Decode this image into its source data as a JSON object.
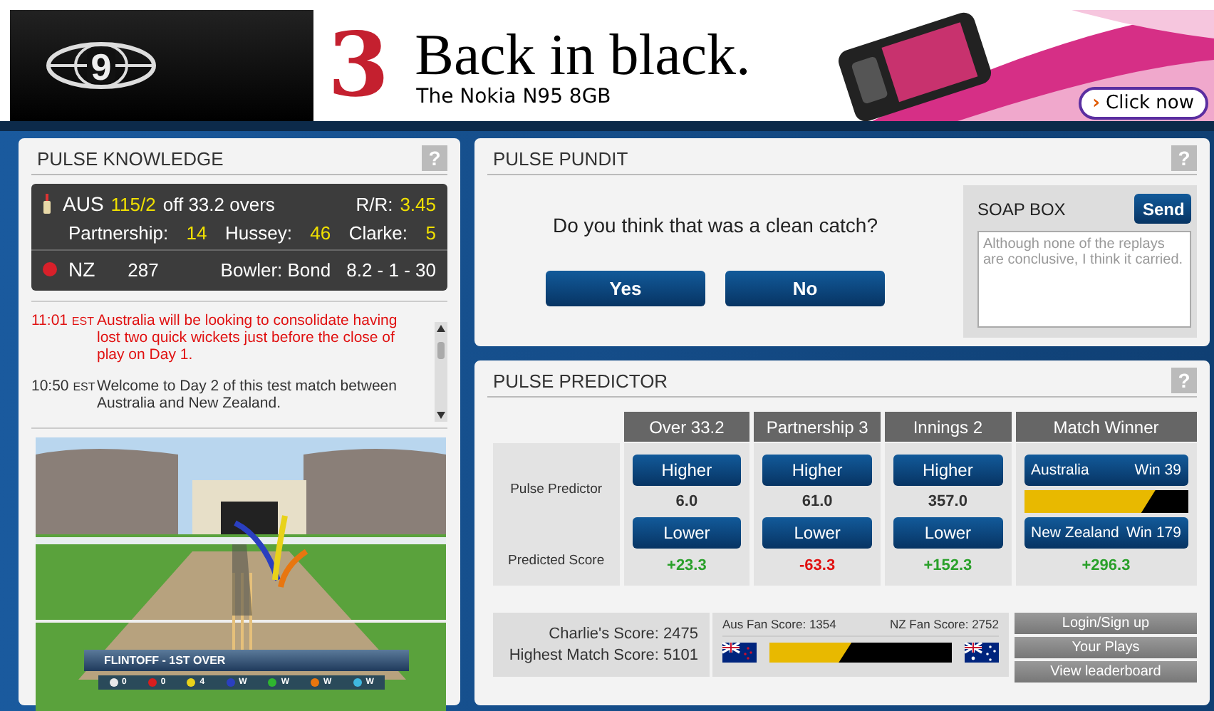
{
  "banner": {
    "logo": "9",
    "brand_mark": "3",
    "headline": "Back in black.",
    "subline": "The Nokia N95 8GB",
    "cta_icon": "›",
    "cta": "Click now"
  },
  "knowledge": {
    "title": "PULSE KNOWLEDGE",
    "help": "?",
    "batting": {
      "team": "AUS",
      "score": "115/2",
      "overs_text": "off 33.2 overs",
      "rr_label": "R/R:",
      "rr": "3.45",
      "stats": [
        {
          "label": "Partnership:",
          "value": "14"
        },
        {
          "label": "Hussey:",
          "value": "46"
        },
        {
          "label": "Clarke:",
          "value": "5"
        }
      ]
    },
    "bowling": {
      "team": "NZ",
      "score": "287",
      "bowler": "Bowler: Bond",
      "figures": "8.2 - 1 - 30"
    },
    "feed": [
      {
        "time": "11:01",
        "zone": "EST",
        "text": "Australia will be looking to consolidate having lost two quick wickets just before the close of play on Day 1.",
        "highlight": true
      },
      {
        "time": "10:50",
        "zone": "EST",
        "text": "Welcome to Day 2 of this test match between Australia and New Zealand.",
        "highlight": false
      }
    ],
    "video": {
      "kind": "picture",
      "caption": "FLINTOFF - 1ST OVER",
      "balls": [
        {
          "color": "#e8e8e8",
          "result": "0"
        },
        {
          "color": "#d81e1e",
          "result": "0"
        },
        {
          "color": "#e8d21a",
          "result": "4"
        },
        {
          "color": "#2a3fc0",
          "result": "W"
        },
        {
          "color": "#2fb52f",
          "result": "W"
        },
        {
          "color": "#e8760f",
          "result": "W"
        },
        {
          "color": "#3fb8e0",
          "result": "W"
        }
      ]
    }
  },
  "pundit": {
    "title": "PULSE PUNDIT",
    "help": "?",
    "question": "Do you think that was a clean catch?",
    "answers": [
      "Yes",
      "No"
    ],
    "soap_box": {
      "title": "SOAP BOX",
      "send": "Send",
      "placeholder": "Although none of the replays are conclusive, I think it carried."
    }
  },
  "predictor": {
    "title": "PULSE PREDICTOR",
    "help": "?",
    "row_labels": [
      "Pulse Predictor",
      "Predicted Score"
    ],
    "columns": [
      {
        "kind": "higher_lower",
        "heading": "Over 33.2",
        "higher": "Higher",
        "value": "6.0",
        "lower": "Lower",
        "score": "+23.3",
        "positive": true
      },
      {
        "kind": "higher_lower",
        "heading": "Partnership 3",
        "higher": "Higher",
        "value": "61.0",
        "lower": "Lower",
        "score": "-63.3",
        "positive": false
      },
      {
        "kind": "higher_lower",
        "heading": "Innings 2",
        "higher": "Higher",
        "value": "357.0",
        "lower": "Lower",
        "score": "+152.3",
        "positive": true
      },
      {
        "kind": "winner",
        "heading": "Match Winner",
        "options": [
          {
            "team": "Australia",
            "odds": "Win 39"
          },
          {
            "team": "New Zealand",
            "odds": "Win 179"
          }
        ],
        "level": 0.8,
        "score": "+296.3",
        "positive": true
      }
    ]
  },
  "scores": {
    "lines": [
      {
        "label": "Charlie's Score:",
        "value": "2475"
      },
      {
        "label": "Highest Match Score:",
        "value": "5101"
      }
    ],
    "fan": {
      "aus": "Aus Fan Score: 1354",
      "nz": "NZ Fan Score: 2752",
      "level": 0.45
    },
    "actions": [
      "Login/Sign up",
      "Your Plays",
      "View leaderboard"
    ]
  }
}
